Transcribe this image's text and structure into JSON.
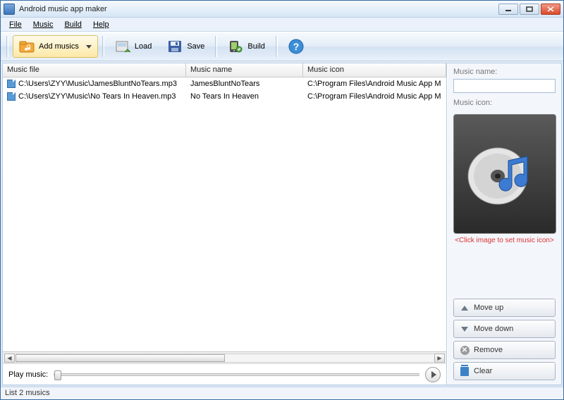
{
  "window": {
    "title": "Android music app maker"
  },
  "menu": {
    "file": "File",
    "music": "Music",
    "build": "Build",
    "help": "Help"
  },
  "toolbar": {
    "add_musics": "Add musics",
    "load": "Load",
    "save": "Save",
    "build": "Build"
  },
  "table": {
    "headers": {
      "file": "Music file",
      "name": "Music name",
      "icon": "Music icon"
    },
    "rows": [
      {
        "file": "C:\\Users\\ZYY\\Music\\JamesBluntNoTears.mp3",
        "name": "JamesBluntNoTears",
        "icon": "C:\\Program Files\\Android Music App M"
      },
      {
        "file": "C:\\Users\\ZYY\\Music\\No Tears In Heaven.mp3",
        "name": "No Tears In Heaven",
        "icon": "C:\\Program Files\\Android Music App M"
      }
    ]
  },
  "playbar": {
    "label": "Play music:"
  },
  "side": {
    "name_label": "Music name:",
    "name_value": "",
    "icon_label": "Music icon:",
    "hint": "<Click image to set music icon>",
    "move_up": "Move up",
    "move_down": "Move down",
    "remove": "Remove",
    "clear": "Clear"
  },
  "status": {
    "text": "List 2 musics"
  }
}
